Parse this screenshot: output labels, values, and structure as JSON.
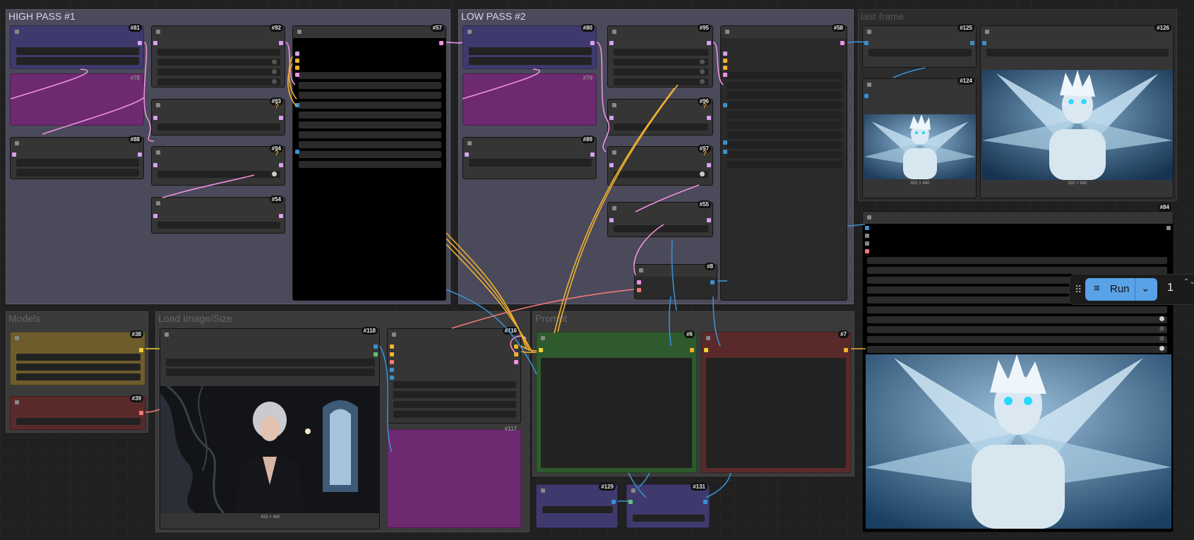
{
  "groups": {
    "high_pass": "HIGH PASS #1",
    "low_pass": "LOW PASS #2",
    "last_frame": "last frame",
    "models": "Models",
    "load_image": "Load Image/Size",
    "prompt": "Prompt"
  },
  "badges": {
    "n81": "#81",
    "n92": "#92",
    "n57": "#57",
    "n78": "#78",
    "n93": "#93",
    "n88": "#88",
    "n94": "#94",
    "n54": "#54",
    "n80": "#80",
    "n95": "#95",
    "n58": "#58",
    "n79": "#79",
    "n96": "#96",
    "n89": "#89",
    "n97": "#97",
    "n55": "#55",
    "n8": "#8",
    "n125": "#125",
    "n126": "#126",
    "n124": "#124",
    "n84": "#84",
    "n38": "#38",
    "n39": "#39",
    "n118": "#118",
    "n116": "#116",
    "n117": "#117",
    "n6": "#6",
    "n7": "#7",
    "n129": "#129",
    "n131": "#131"
  },
  "captions": {
    "frame_small": "832 × 480",
    "frame_large": "832 × 480",
    "load_image": "832 × 480"
  },
  "toolbar": {
    "drag_handle": "⠿",
    "run_label": "Run",
    "run_icon": "≡",
    "chevron": "⌄",
    "queue_count": "1",
    "spinner": "⌃⌄"
  },
  "colors": {
    "high_pass_group": "#444452",
    "models_group": "#3a3a3a",
    "lora_node": "#3f3a6e",
    "pink_node": "#6d2a70",
    "positive_prompt": "#2e5a2e",
    "negative_prompt": "#5a2a2a",
    "run_button": "#5aa2e8",
    "wire_orange": "#f0b030",
    "wire_pink": "#f090e0",
    "wire_blue": "#3a90d0",
    "wire_salmon": "#f07878"
  }
}
